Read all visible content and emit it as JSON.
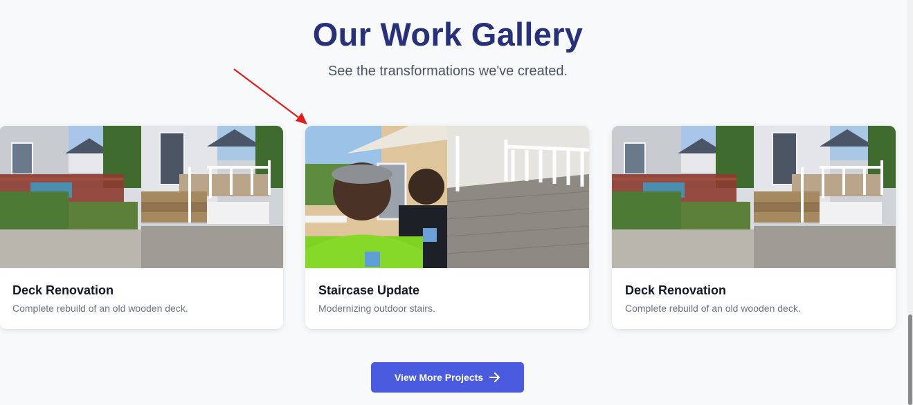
{
  "gallery": {
    "title": "Our Work Gallery",
    "subtitle": "See the transformations we've created.",
    "cards": [
      {
        "title": "Deck Renovation",
        "description": "Complete rebuild of an old wooden deck."
      },
      {
        "title": "Staircase Update",
        "description": "Modernizing outdoor stairs."
      },
      {
        "title": "Deck Renovation",
        "description": "Complete rebuild of an old wooden deck."
      }
    ],
    "cta": {
      "label": "View More Projects",
      "icon": "arrow-right-icon"
    }
  },
  "colors": {
    "title": "#27317a",
    "button": "#4a5be0",
    "background": "#f8f9fb",
    "annotation": "#e11d1d"
  }
}
